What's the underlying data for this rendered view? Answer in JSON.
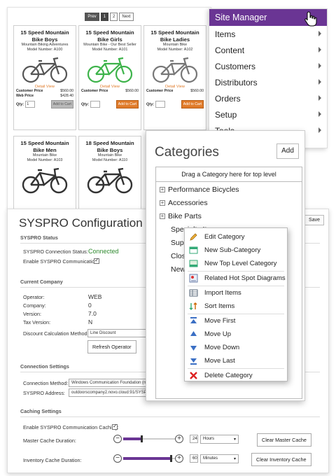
{
  "pager": {
    "prev": "Prev",
    "page1": "1",
    "page2": "2",
    "next": "Next"
  },
  "products": [
    {
      "name": "15 Speed Mountain Bike Boys",
      "brand": "Mountain Biking Adventures",
      "model": "Model Number: A100",
      "detail": "Detail View",
      "customer_price_label": "Customer Price",
      "customer_price": "$560.00",
      "web_price_label": "Web Price",
      "web_price": "$428.40",
      "qty_label": "Qty:",
      "qty": "1",
      "button": "Add to Cart",
      "color": "#555555"
    },
    {
      "name": "15 Speed Mountain Bike Girls",
      "brand": "Mountain Bike - Our Best Seller",
      "model": "Model Number: A101",
      "detail": "Detail View",
      "customer_price_label": "Customer Price",
      "customer_price": "$560.00",
      "qty_label": "Qty:",
      "qty": "",
      "button": "Add to Cart",
      "color": "#3db34a"
    },
    {
      "name": "15 Speed Mountain Bike Ladies",
      "brand": "Mountain Bike",
      "model": "Model Number: A102",
      "detail": "Detail View",
      "customer_price_label": "Customer Price",
      "customer_price": "$560.00",
      "qty_label": "Qty:",
      "qty": "",
      "button": "Add to Cart",
      "color": "#777777"
    },
    {
      "name": "15 Speed Mountain Bike Men",
      "brand": "Mountain Bike",
      "model": "Model Number: A103",
      "color": "#333333"
    },
    {
      "name": "18 Speed Mountain Bike Boys",
      "brand": "Mountain Bike",
      "model": "Model Number: A110",
      "color": "#333333"
    }
  ],
  "site_manager": {
    "title": "Site Manager",
    "items": [
      "Items",
      "Content",
      "Customers",
      "Distributors",
      "Orders",
      "Setup",
      "Tools"
    ]
  },
  "categories": {
    "title": "Categories",
    "add_button": "Add",
    "drop_hint": "Drag a Category here for top level",
    "nodes": [
      "Performance Bicycles",
      "Accessories",
      "Bike Parts",
      "Specialty Items",
      "Supp",
      "Clos",
      "New"
    ]
  },
  "context_menu": {
    "items": [
      "Edit Category",
      "New Sub-Category",
      "New Top Level Category",
      "Related Hot Spot Diagrams",
      "Import Items",
      "Sort Items",
      "Move First",
      "Move Up",
      "Move Down",
      "Move Last",
      "Delete Category"
    ]
  },
  "syspro": {
    "title": "SYSPRO Configuration",
    "save_button": "Save",
    "status_section": "SYSPRO Status",
    "connection_status_label": "SYSPRO Connection Status:",
    "connection_status": "Connected",
    "enable_comm_label": "Enable SYSPRO Communication:",
    "company_section": "Current Company",
    "operator_label": "Operator:",
    "operator": "WEB",
    "company_label": "Company:",
    "company": "0",
    "version_label": "Version:",
    "version": "7.0",
    "tax_version_label": "Tax Version:",
    "tax_version": "N",
    "discount_label": "Discount Calculation Method:",
    "discount_value": "Line Discount",
    "refresh_button": "Refresh Operator",
    "connection_section": "Connection Settings",
    "method_label": "Connection Method:",
    "method_value": "Windows Communication Foundation (ne",
    "address_label": "SYSPRO Address:",
    "address_value": "outdoorscompany2.novo.cloud:91/SYSPR",
    "caching_section": "Caching Settings",
    "enable_caching_label": "Enable SYSPRO Communication Caching:",
    "master_label": "Master Cache Duration:",
    "master_value": "24",
    "master_unit": "Hours",
    "master_button": "Clear Master Cache",
    "master_level": 0.35,
    "inventory_label": "Inventory Cache Duration:",
    "inventory_value": "60",
    "inventory_unit": "Minutes",
    "inventory_button": "Clear Inventory Cache",
    "inventory_level": 0.92
  },
  "colors": {
    "accent": "#6a3594",
    "orange": "#e07b2a",
    "ok": "#2f8a2f"
  }
}
